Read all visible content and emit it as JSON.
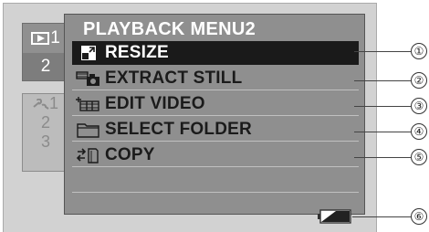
{
  "tabs": {
    "playback": {
      "icon": "playback-icon",
      "row1": "1",
      "row2": "2"
    },
    "setup": {
      "icon": "wrench-icon",
      "rows": [
        "1",
        "2",
        "3"
      ]
    }
  },
  "menu": {
    "title": "PLAYBACK MENU2",
    "items": [
      {
        "label": "RESIZE",
        "icon": "resize-icon",
        "selected": true
      },
      {
        "label": "EXTRACT STILL",
        "icon": "extract-still-icon",
        "selected": false
      },
      {
        "label": "EDIT VIDEO",
        "icon": "edit-video-icon",
        "selected": false
      },
      {
        "label": "SELECT FOLDER",
        "icon": "folder-icon",
        "selected": false
      },
      {
        "label": "COPY",
        "icon": "copy-icon",
        "selected": false
      }
    ]
  },
  "callouts": [
    "①",
    "②",
    "③",
    "④",
    "⑤",
    "⑥"
  ],
  "colors": {
    "selected_bg": "#1a1a1a",
    "panel_bg": "#8f8f8f",
    "screen_bg": "#d2d2d2"
  }
}
